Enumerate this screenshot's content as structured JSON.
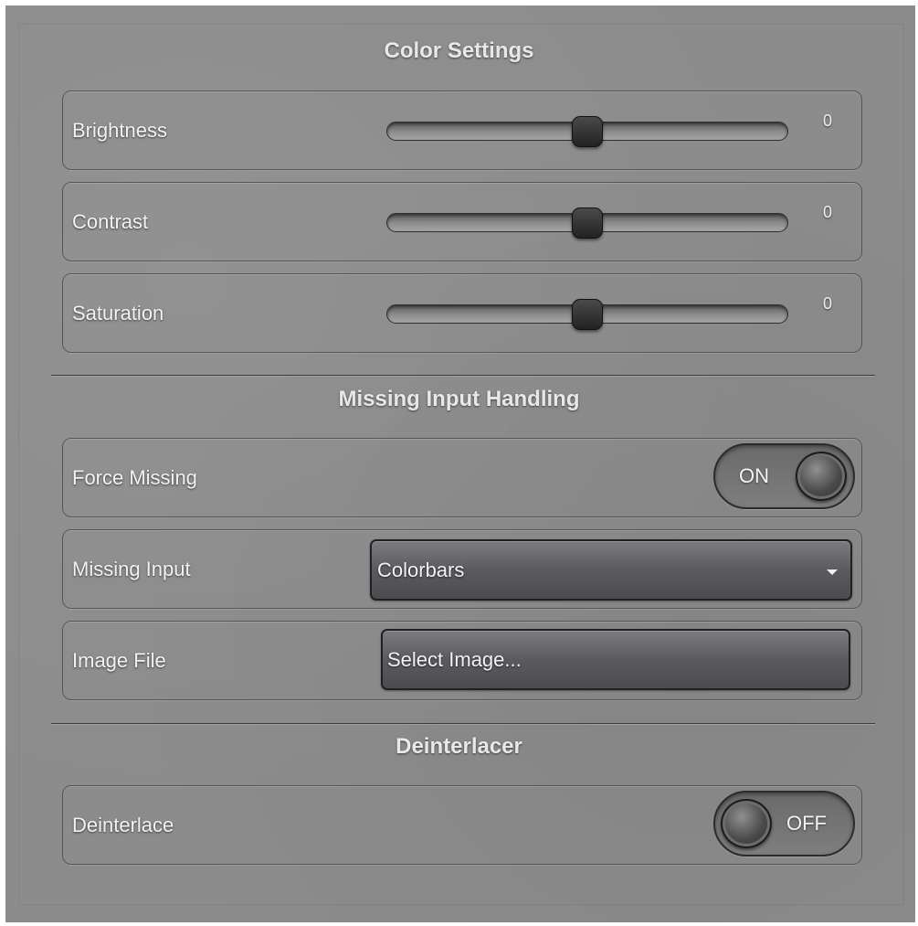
{
  "color_settings": {
    "title": "Color Settings",
    "brightness": {
      "label": "Brightness",
      "value": "0",
      "level": 0.5
    },
    "contrast": {
      "label": "Contrast",
      "value": "0",
      "level": 0.5
    },
    "saturation": {
      "label": "Saturation",
      "value": "0",
      "level": 0.5
    }
  },
  "missing_input_handling": {
    "title": "Missing Input Handling",
    "force_missing": {
      "label": "Force Missing",
      "state": "ON"
    },
    "missing_input": {
      "label": "Missing Input",
      "selected": "Colorbars"
    },
    "image_file": {
      "label": "Image File",
      "button_text": "Select Image..."
    }
  },
  "deinterlacer": {
    "title": "Deinterlacer",
    "deinterlace": {
      "label": "Deinterlace",
      "state": "OFF"
    }
  },
  "colors": {
    "panel_background": "#8c8c8c",
    "text": "#f2f2f2",
    "control_dark": "#2b2b2b"
  },
  "icons": {
    "dropdown": "chevron-down-icon",
    "slider_thumb": "slider-thumb",
    "toggle_knob": "toggle-knob"
  }
}
